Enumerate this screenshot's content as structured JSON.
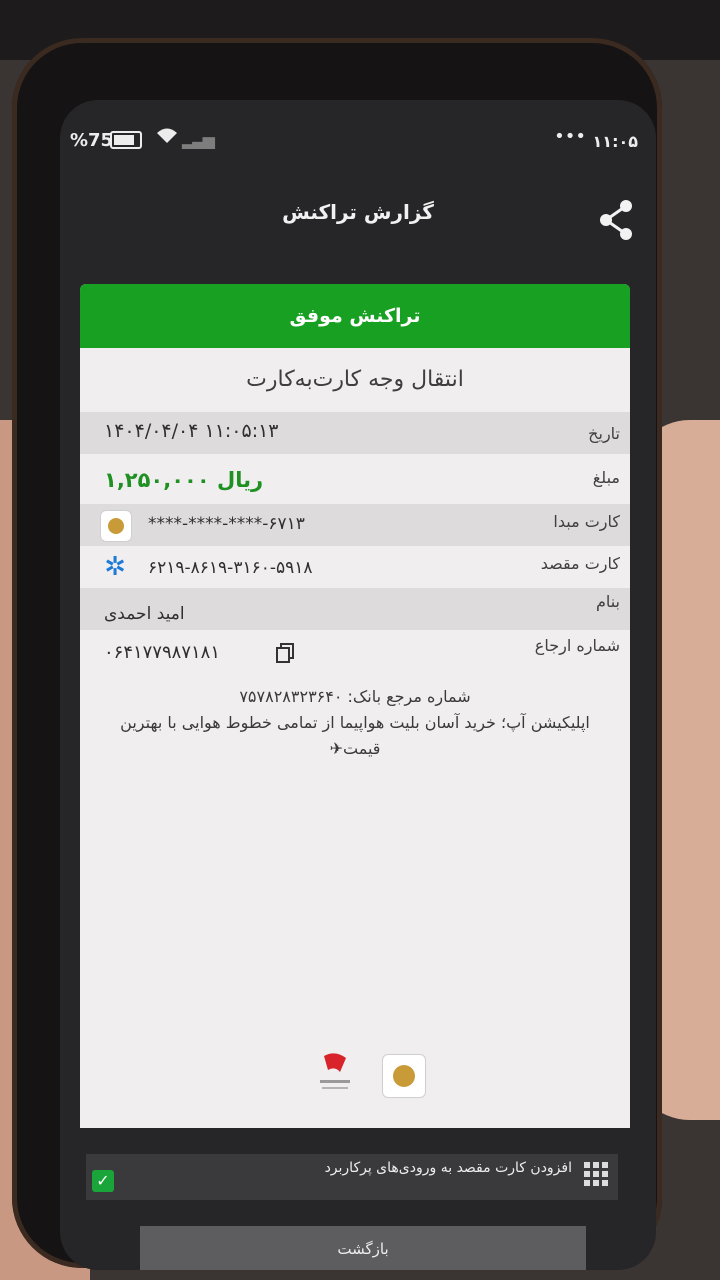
{
  "status_bar": {
    "battery": "%75",
    "time": "۱۱:۰۵",
    "dots": "•••"
  },
  "header": {
    "title": "گزارش تراکنش"
  },
  "receipt": {
    "status": "تراکنش موفق",
    "type": "انتقال وجه کارت‌به‌کارت",
    "rows": [
      {
        "label": "تاریخ",
        "value": "۱۴۰۴/۰۴/۰۴ ۱۱:۰۵:۱۳"
      },
      {
        "label": "مبلغ",
        "value": "۱,۲۵۰,۰۰۰ ریال"
      },
      {
        "label": "کارت مبدا",
        "value": "****-****-****-۶۷۱۳"
      },
      {
        "label": "کارت مقصد",
        "value": "۶۲۱۹-۸۶۱۹-۳۱۶۰-۵۹۱۸"
      },
      {
        "label": "بنام",
        "value": "امید احمدی"
      },
      {
        "label": "شماره ارجاع",
        "value": "۰۶۴۱۷۷۹۸۷۱۸۱"
      }
    ],
    "bank_ref": "شماره مرجع بانک: ۷۵۷۸۲۸۳۲۳۶۴۰",
    "promo": "اپلیکیشن آپ؛ خرید آسان بلیت هواپیما از تمامی خطوط هوایی با بهترین قیمت✈"
  },
  "footer": {
    "add_card_text": "افزودن کارت مقصد به ورودی‌های پرکاربرد",
    "back_label": "بازگشت"
  },
  "colors": {
    "success_green": "#18a023",
    "amount_green": "#1f9122",
    "checkbox_green": "#19a53a"
  }
}
